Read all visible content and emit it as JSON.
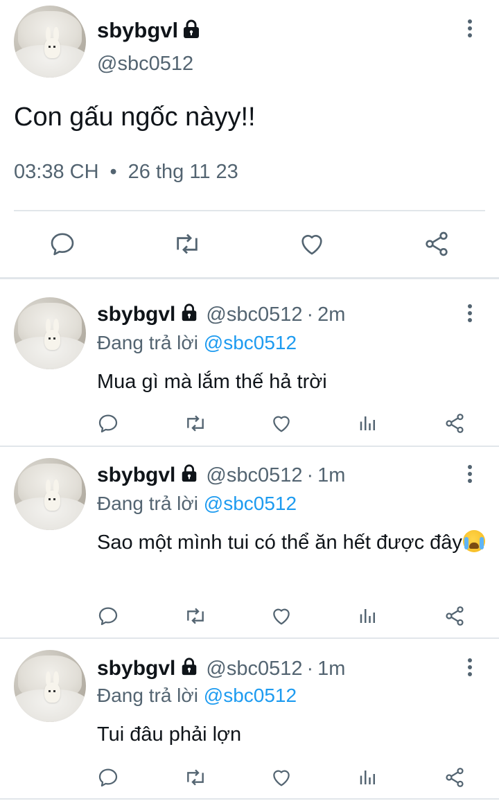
{
  "main_tweet": {
    "display_name": "sbybgvl",
    "handle": "@sbc0512",
    "text": "Con gấu ngốc nàyy!!",
    "time": "03:38 CH",
    "date": "26 thg 11 23",
    "actions": [
      "reply-icon",
      "retweet-icon",
      "like-icon",
      "share-icon"
    ]
  },
  "replies": [
    {
      "display_name": "sbybgvl",
      "handle": "@sbc0512",
      "separator": "·",
      "time": "2m",
      "replying_label": "Đang trả lời",
      "replying_to": "@sbc0512",
      "text": "Mua gì mà lắm thế hả trời"
    },
    {
      "display_name": "sbybgvl",
      "handle": "@sbc0512",
      "separator": "·",
      "time": "1m",
      "replying_label": "Đang trả lời",
      "replying_to": "@sbc0512",
      "text": "Sao một mình tui có thể ăn hết được đây"
    },
    {
      "display_name": "sbybgvl",
      "handle": "@sbc0512",
      "separator": "·",
      "time": "1m",
      "replying_label": "Đang trả lời",
      "replying_to": "@sbc0512",
      "text": "Tui đâu phải lợn"
    }
  ],
  "meta_separator": "•",
  "colors": {
    "text": "#0f1419",
    "secondary": "#536471",
    "link": "#1d9bf0",
    "divider": "#e1e6ea"
  }
}
